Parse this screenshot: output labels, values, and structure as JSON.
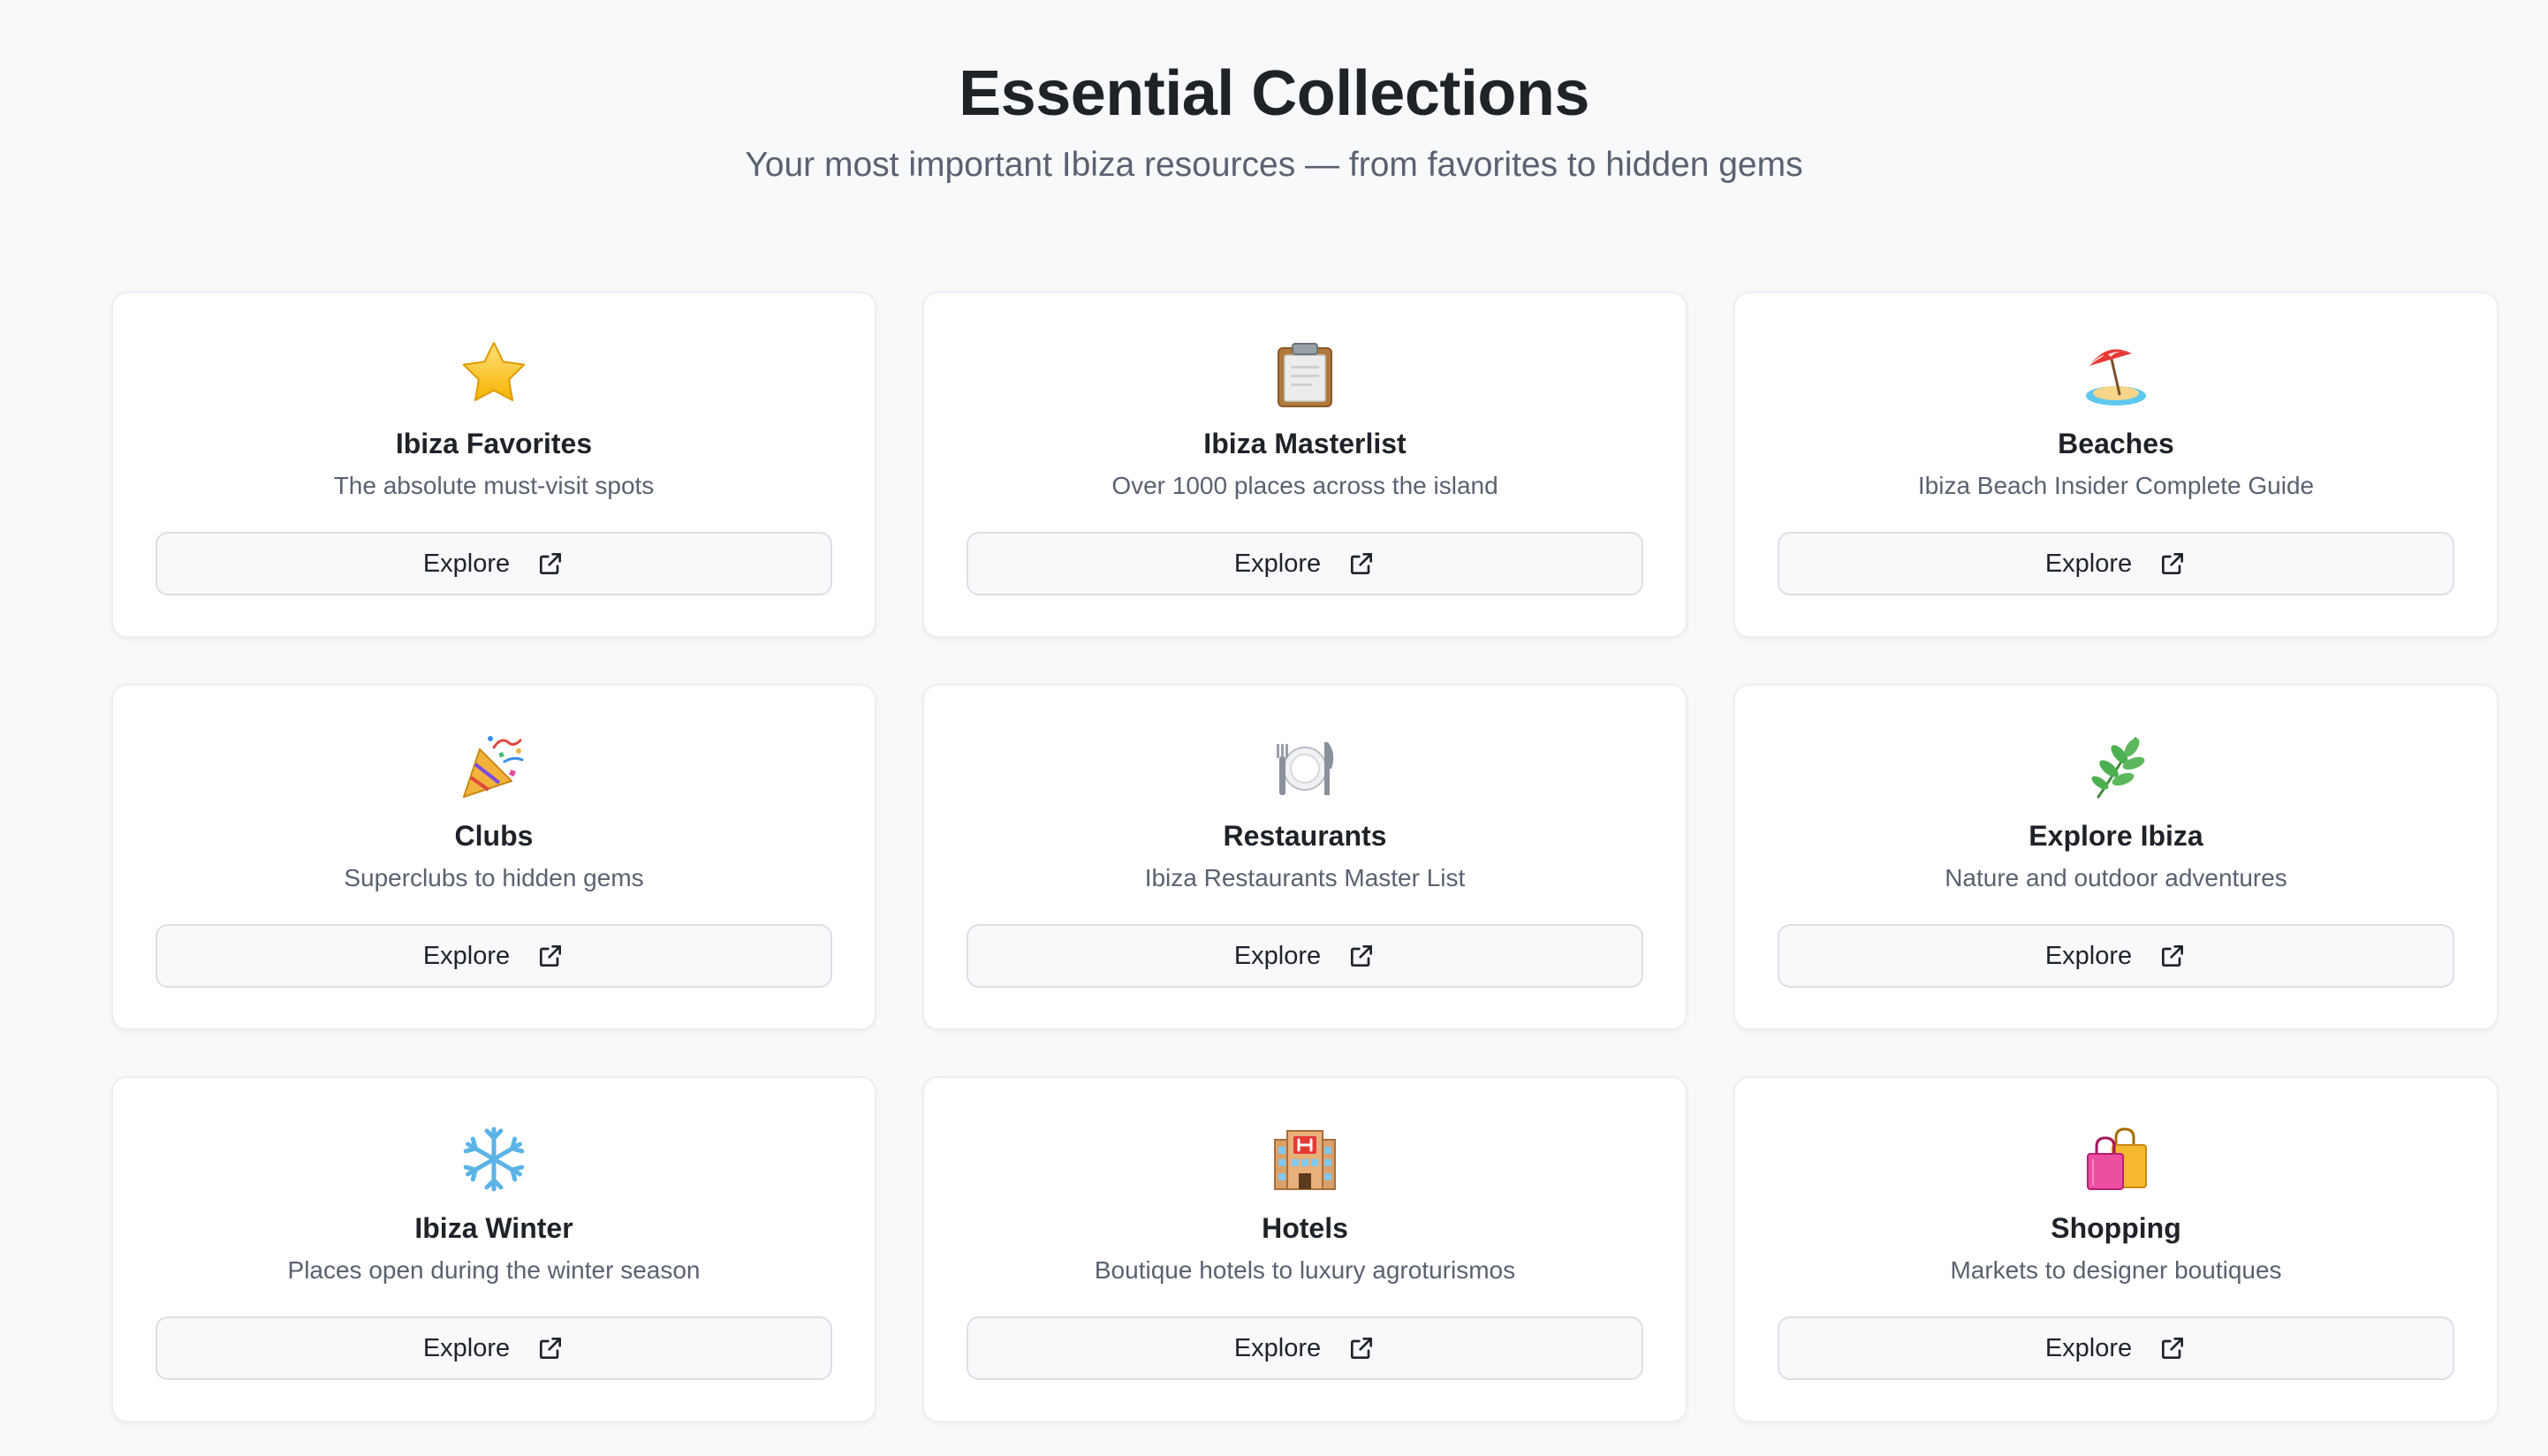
{
  "header": {
    "title": "Essential Collections",
    "subtitle": "Your most important Ibiza resources — from favorites to hidden gems"
  },
  "cards": [
    {
      "icon": "star-icon",
      "title": "Ibiza Favorites",
      "description": "The absolute must-visit spots",
      "button_label": "Explore"
    },
    {
      "icon": "clipboard-icon",
      "title": "Ibiza Masterlist",
      "description": "Over 1000 places across the island",
      "button_label": "Explore"
    },
    {
      "icon": "beach-umbrella-icon",
      "title": "Beaches",
      "description": "Ibiza Beach Insider Complete Guide",
      "button_label": "Explore"
    },
    {
      "icon": "party-popper-icon",
      "title": "Clubs",
      "description": "Superclubs to hidden gems",
      "button_label": "Explore"
    },
    {
      "icon": "fork-knife-plate-icon",
      "title": "Restaurants",
      "description": "Ibiza Restaurants Master List",
      "button_label": "Explore"
    },
    {
      "icon": "herb-icon",
      "title": "Explore Ibiza",
      "description": "Nature and outdoor adventures",
      "button_label": "Explore"
    },
    {
      "icon": "snowflake-icon",
      "title": "Ibiza Winter",
      "description": "Places open during the winter season",
      "button_label": "Explore"
    },
    {
      "icon": "hotel-icon",
      "title": "Hotels",
      "description": "Boutique hotels to luxury agroturismos",
      "button_label": "Explore"
    },
    {
      "icon": "shopping-bags-icon",
      "title": "Shopping",
      "description": "Markets to designer boutiques",
      "button_label": "Explore"
    }
  ],
  "colors": {
    "background": "#f8f9fb",
    "card_background": "#ffffff",
    "card_border": "#eceef2",
    "title_text": "#1f2328",
    "muted_text": "#5a6170",
    "button_border": "#dcdfe5"
  }
}
